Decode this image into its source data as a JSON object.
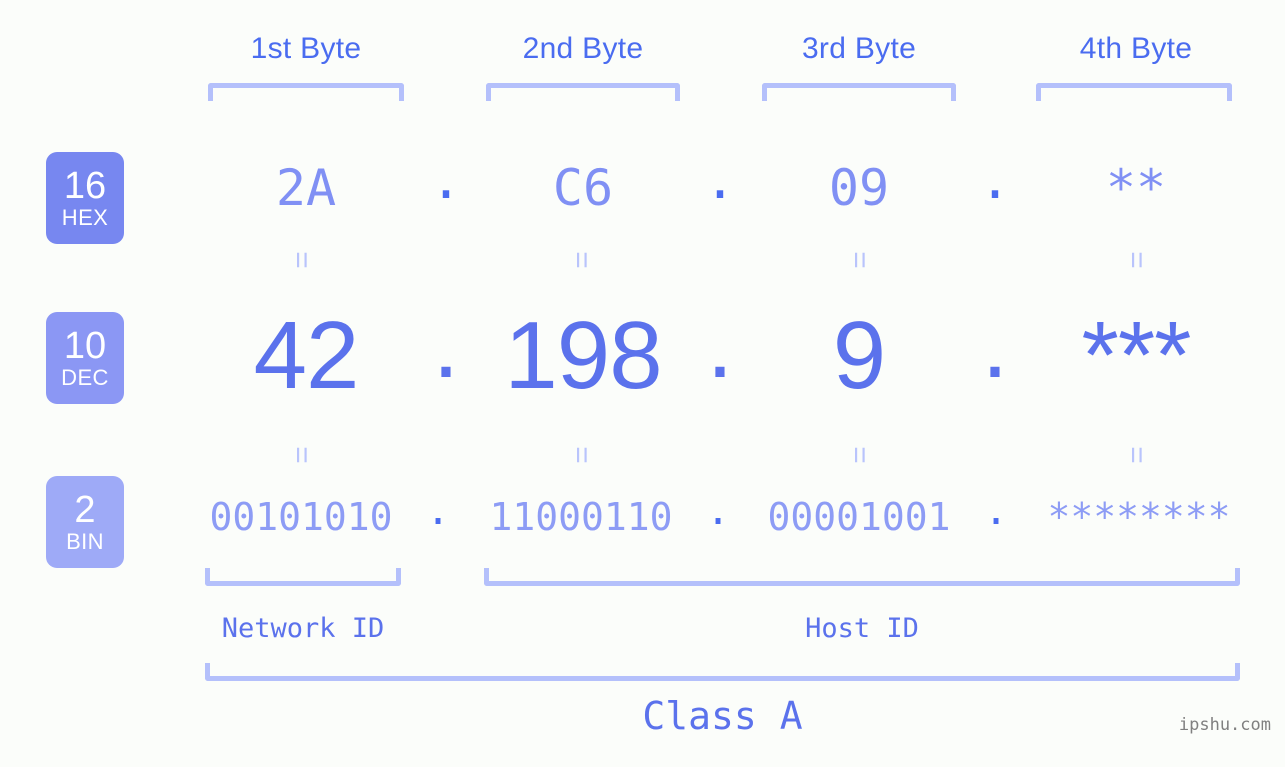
{
  "page": {
    "background_color": "#fbfdfa",
    "watermark": "ipshu.com"
  },
  "colors": {
    "header_text": "#4a6cf0",
    "bracket": "#b4c0fb",
    "hex_value": "#8090f4",
    "dec_value": "#5b72ec",
    "bin_value": "#8d9cf5",
    "badge_hex": "#7787f0",
    "badge_dec": "#8b97f4",
    "badge_bin": "#9eaaf7",
    "equals": "#b9c4fc",
    "watermark": "#808080"
  },
  "byte_headers": [
    {
      "label": "1st Byte"
    },
    {
      "label": "2nd Byte"
    },
    {
      "label": "3rd Byte"
    },
    {
      "label": "4th Byte"
    }
  ],
  "base_badges": [
    {
      "number": "16",
      "name": "HEX"
    },
    {
      "number": "10",
      "name": "DEC"
    },
    {
      "number": "2",
      "name": "BIN"
    }
  ],
  "rows": {
    "hex": {
      "base_number": "16",
      "base_name": "HEX",
      "values": [
        "2A",
        "C6",
        "09",
        "**"
      ],
      "separators": [
        ".",
        ".",
        "."
      ]
    },
    "dec": {
      "base_number": "10",
      "base_name": "DEC",
      "values": [
        "42",
        "198",
        "9",
        "***"
      ],
      "separators": [
        ".",
        ".",
        "."
      ]
    },
    "bin": {
      "base_number": "2",
      "base_name": "BIN",
      "values": [
        "00101010",
        "11000110",
        "00001001",
        "********"
      ],
      "separators": [
        ".",
        ".",
        "."
      ]
    }
  },
  "equals_markers": {
    "symbol": "=",
    "count_per_gap": 4,
    "gaps": 2
  },
  "segments": {
    "network_id": "Network ID",
    "host_id": "Host ID",
    "ip_class": "Class A"
  }
}
